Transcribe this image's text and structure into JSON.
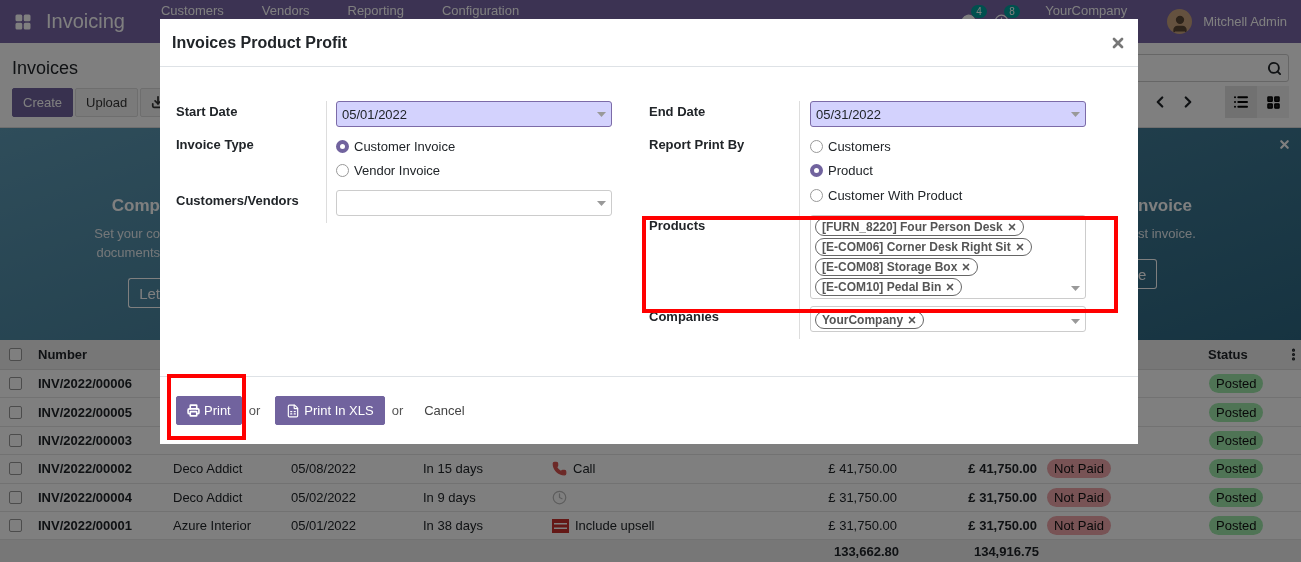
{
  "navbar": {
    "app_name": "Invoicing",
    "menus": [
      "Customers",
      "Vendors",
      "Reporting",
      "Configuration"
    ],
    "messages_badge": "4",
    "activities_badge": "8",
    "company": "YourCompany",
    "user": "Mitchell Admin"
  },
  "control_panel": {
    "title": "Invoices",
    "buttons": [
      "Create",
      "Upload"
    ]
  },
  "banner": {
    "left_title": "Comp",
    "left_lines": [
      "Set your co",
      "documents"
    ],
    "left_button": "Let",
    "right_title": "nvoice",
    "right_line": "st invoice.",
    "right_button": "e"
  },
  "table": {
    "columns": [
      "Number",
      "Status"
    ],
    "all_checked": false,
    "rows": [
      {
        "checked": false,
        "number": "INV/2022/00006",
        "status": "Posted"
      },
      {
        "checked": false,
        "number": "INV/2022/00005",
        "status": "Posted"
      },
      {
        "checked": false,
        "number": "INV/2022/00003",
        "status": "Posted"
      },
      {
        "checked": false,
        "number": "INV/2022/00002",
        "customer": "Deco Addict",
        "date": "05/08/2022",
        "due": "In 15 days",
        "activity": {
          "kind": "phone",
          "text": "Call"
        },
        "untaxed": "£ 41,750.00",
        "total": "£ 41,750.00",
        "payment": "Not Paid",
        "status": "Posted"
      },
      {
        "checked": false,
        "number": "INV/2022/00004",
        "customer": "Deco Addict",
        "date": "05/02/2022",
        "due": "In 9 days",
        "activity": {
          "kind": "clock"
        },
        "untaxed": "£ 31,750.00",
        "total": "£ 31,750.00",
        "payment": "Not Paid",
        "status": "Posted"
      },
      {
        "checked": false,
        "number": "INV/2022/00001",
        "customer": "Azure Interior",
        "date": "05/01/2022",
        "due": "In 38 days",
        "activity": {
          "kind": "upsell",
          "text": "Include upsell"
        },
        "untaxed": "£ 31,750.00",
        "total": "£ 31,750.00",
        "payment": "Not Paid",
        "status": "Posted"
      }
    ],
    "totals": {
      "untaxed": "133,662.80",
      "total": "134,916.75"
    }
  },
  "dialog": {
    "title": "Invoices Product Profit",
    "start_date": {
      "label": "Start Date",
      "value": "05/01/2022"
    },
    "invoice_type": {
      "label": "Invoice Type",
      "options": [
        {
          "label": "Customer Invoice",
          "selected": true
        },
        {
          "label": "Vendor Invoice",
          "selected": false
        }
      ]
    },
    "partners": {
      "label": "Customers/Vendors"
    },
    "end_date": {
      "label": "End Date",
      "value": "05/31/2022"
    },
    "report_print_by": {
      "label": "Report Print By",
      "options": [
        {
          "label": "Customers",
          "selected": false
        },
        {
          "label": "Product",
          "selected": true
        },
        {
          "label": "Customer With Product",
          "selected": false
        }
      ]
    },
    "products": {
      "label": "Products",
      "tags": [
        "[FURN_8220] Four Person Desk",
        "[E-COM06] Corner Desk Right Sit",
        "[E-COM08] Storage Box",
        "[E-COM10] Pedal Bin"
      ]
    },
    "companies": {
      "label": "Companies",
      "tags": [
        "YourCompany"
      ]
    },
    "footer": {
      "print": "Print",
      "print_xls": "Print In XLS",
      "separators": [
        "or",
        "or"
      ],
      "cancel": "Cancel"
    }
  }
}
